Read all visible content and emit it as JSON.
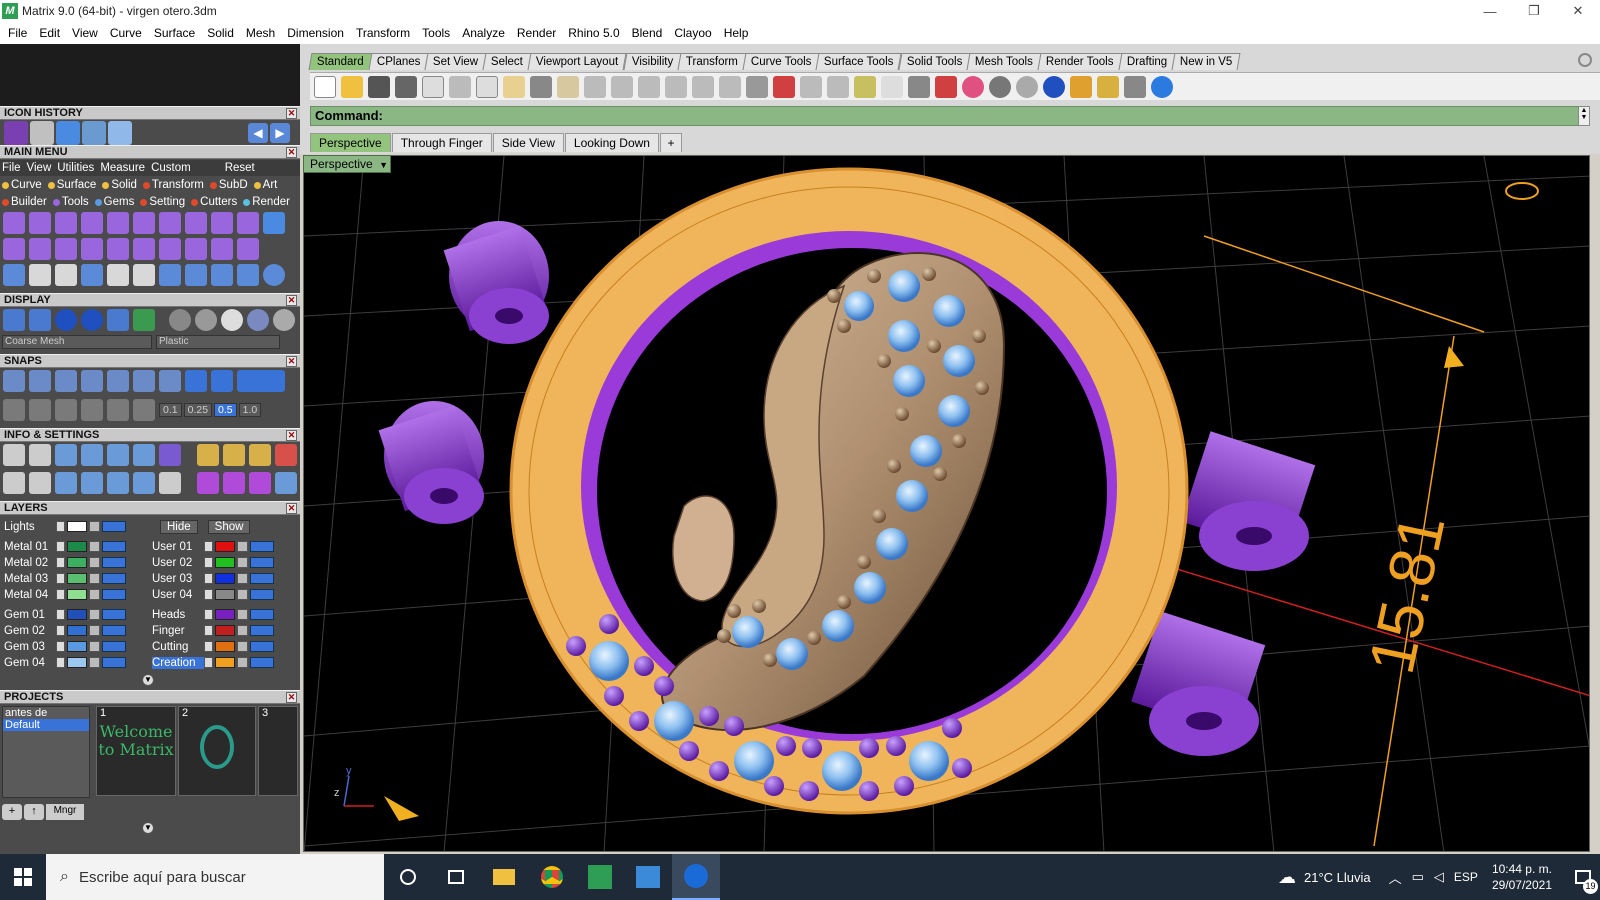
{
  "window": {
    "title": "Matrix 9.0 (64-bit) - virgen otero.3dm",
    "app_icon_letter": "M",
    "controls": [
      "—",
      "❐",
      "✕"
    ]
  },
  "menubar": [
    "File",
    "Edit",
    "View",
    "Curve",
    "Surface",
    "Solid",
    "Mesh",
    "Dimension",
    "Transform",
    "Tools",
    "Analyze",
    "Render",
    "Rhino 5.0",
    "Blend",
    "Clayoo",
    "Help"
  ],
  "left_panel": {
    "icon_history": "ICON HISTORY",
    "main_menu": {
      "title": "MAIN MENU",
      "menu_items": [
        "File",
        "View",
        "Utilities",
        "Measure",
        "Custom"
      ],
      "reset": "Reset",
      "row1": [
        {
          "label": "Curve",
          "color": "#f0c040"
        },
        {
          "label": "Surface",
          "color": "#f0c040"
        },
        {
          "label": "Solid",
          "color": "#f0c040"
        },
        {
          "label": "Transform",
          "color": "#e04a2a"
        },
        {
          "label": "SubD",
          "color": "#e04a2a"
        },
        {
          "label": "Art",
          "color": "#f0c040"
        }
      ],
      "row2": [
        {
          "label": "Builder",
          "color": "#e04a2a"
        },
        {
          "label": "Tools",
          "color": "#9a66dd"
        },
        {
          "label": "Gems",
          "color": "#5a9ae0"
        },
        {
          "label": "Setting",
          "color": "#e04a2a"
        },
        {
          "label": "Cutters",
          "color": "#e04a2a"
        },
        {
          "label": "Render",
          "color": "#5ac0e0"
        }
      ]
    },
    "display": {
      "title": "DISPLAY",
      "mesh_select": "Coarse Mesh",
      "material_select": "Plastic"
    },
    "snaps": {
      "title": "SNAPS",
      "values": [
        "0.1",
        "0.25",
        "0.5",
        "1.0"
      ]
    },
    "info_settings": "INFO & SETTINGS",
    "layers": {
      "title": "LAYERS",
      "lights": "Lights",
      "hide": "Hide",
      "show": "Show",
      "left": [
        {
          "name": "Metal 01",
          "color": "#1e8a4a"
        },
        {
          "name": "Metal 02",
          "color": "#3cb060"
        },
        {
          "name": "Metal 03",
          "color": "#5ac070"
        },
        {
          "name": "Metal 04",
          "color": "#8ee090"
        },
        {
          "name": "Gem 01",
          "color": "#2050b8"
        },
        {
          "name": "Gem 02",
          "color": "#3070d0"
        },
        {
          "name": "Gem 03",
          "color": "#5a9ae0"
        },
        {
          "name": "Gem 04",
          "color": "#9cc8f0"
        }
      ],
      "right": [
        {
          "name": "User 01",
          "color": "#e01010"
        },
        {
          "name": "User 02",
          "color": "#20c020"
        },
        {
          "name": "User 03",
          "color": "#1030e0"
        },
        {
          "name": "User 04",
          "color": "#888888"
        },
        {
          "name": "Heads",
          "color": "#7a20c0"
        },
        {
          "name": "Finger",
          "color": "#c02020"
        },
        {
          "name": "Cutting",
          "color": "#e07010"
        },
        {
          "name": "Creation",
          "color": "#f0a020"
        }
      ]
    },
    "projects": {
      "title": "PROJECTS",
      "list": [
        "antes de",
        "Default"
      ],
      "thumbs": [
        {
          "num": "1",
          "text": "Welcome to Matrix"
        },
        {
          "num": "2",
          "text": ""
        },
        {
          "num": "3",
          "text": ""
        }
      ],
      "mngr": "Mngr"
    }
  },
  "toolbar_tabs": [
    "Standard",
    "CPlanes",
    "Set View",
    "Select",
    "Viewport Layout",
    "Visibility",
    "Transform",
    "Curve Tools",
    "Surface Tools",
    "Solid Tools",
    "Mesh Tools",
    "Render Tools",
    "Drafting",
    "New in V5"
  ],
  "command": {
    "label": "Command:"
  },
  "viewport_tabs": [
    "Perspective",
    "Through Finger",
    "Side View",
    "Looking Down"
  ],
  "viewport": {
    "name": "Perspective",
    "dimension": "15.81",
    "axis_z": "z",
    "axis_y": "y"
  },
  "taskbar": {
    "search_placeholder": "Escribe aquí para buscar",
    "weather": "21°C  Lluvia",
    "lang": "ESP",
    "time": "10:44 p. m.",
    "date": "29/07/2021",
    "notifications": "19"
  }
}
